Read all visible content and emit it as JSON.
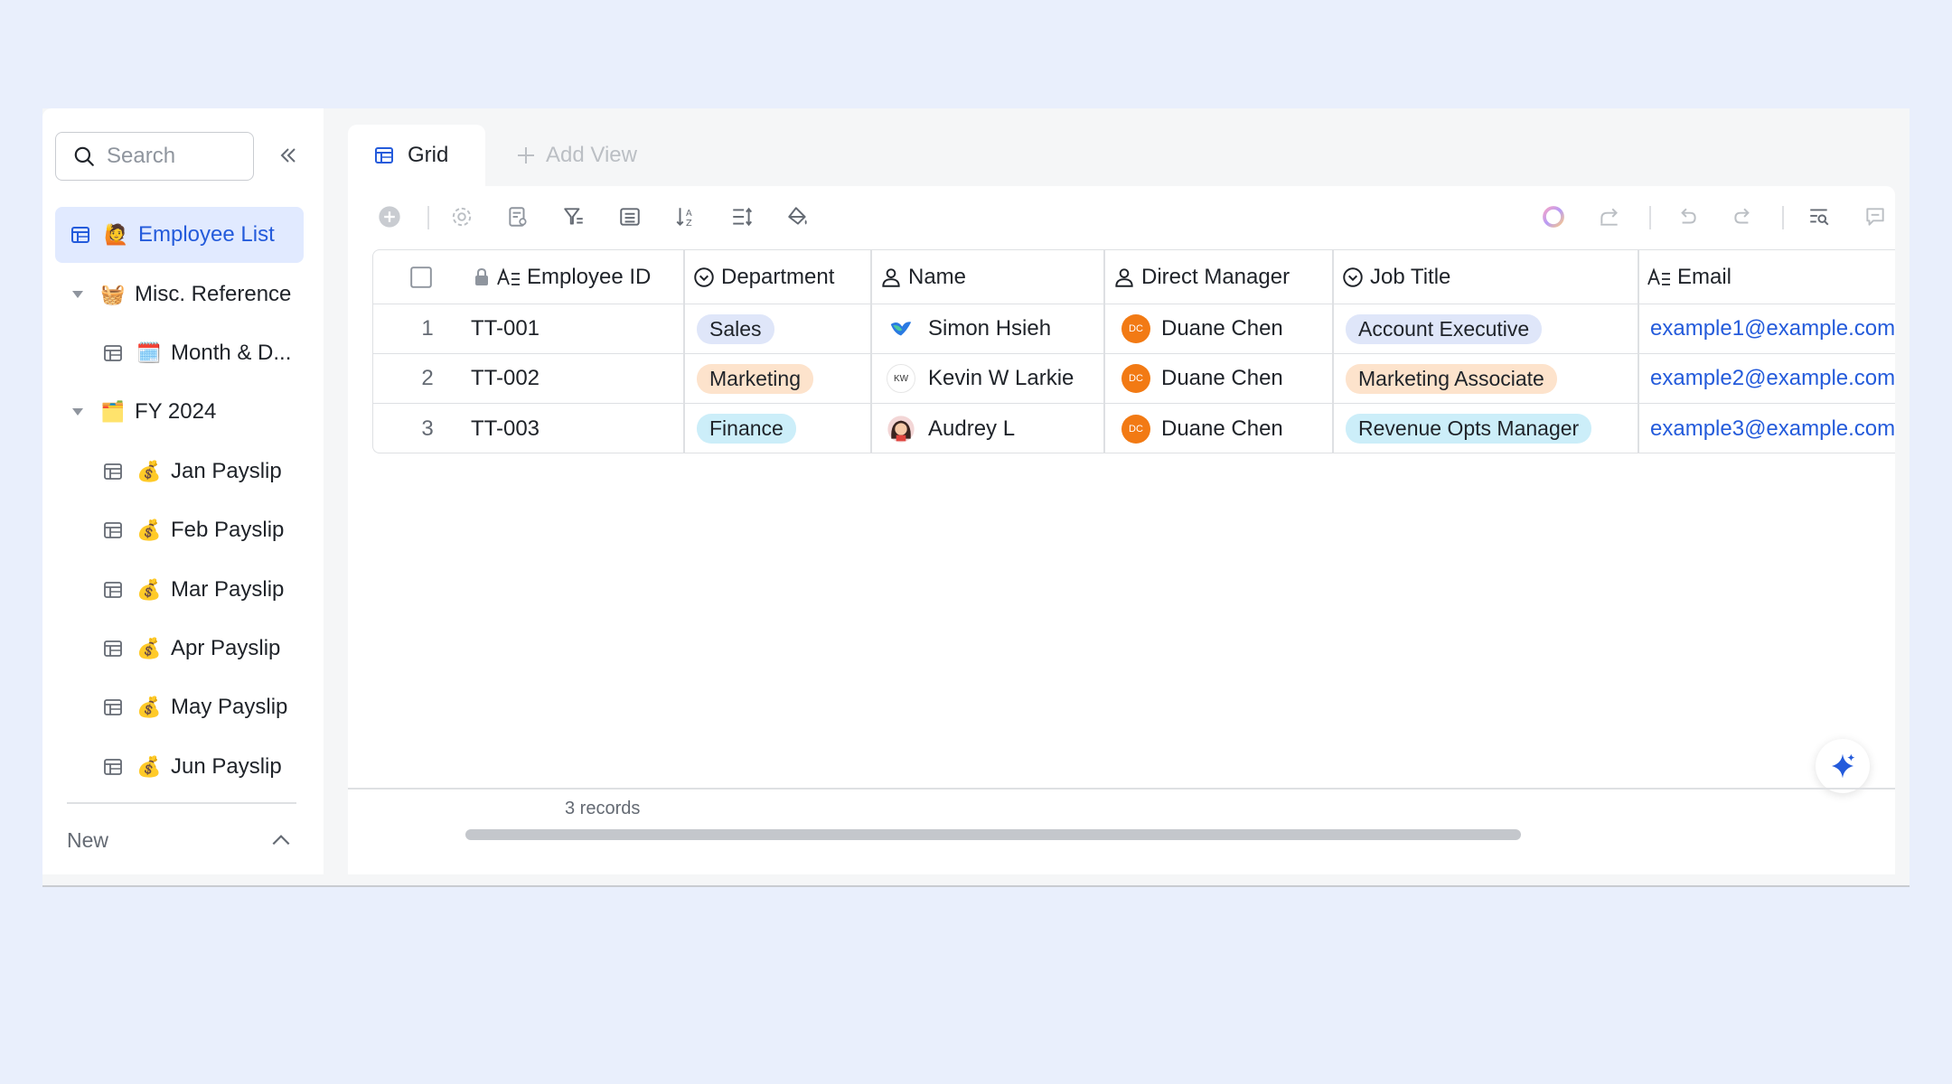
{
  "sidebar": {
    "search_placeholder": "Search",
    "items": [
      {
        "label": "Employee List",
        "emoji": "🙋",
        "active": true
      },
      {
        "label": "Misc. Reference",
        "emoji": "🧺",
        "folder": true
      },
      {
        "label": "Month & D...",
        "emoji": "🗓️"
      },
      {
        "label": "FY 2024",
        "emoji": "🗂️",
        "folder": true
      },
      {
        "label": "Jan Payslip",
        "emoji": "💰"
      },
      {
        "label": "Feb Payslip",
        "emoji": "💰"
      },
      {
        "label": "Mar Payslip",
        "emoji": "💰"
      },
      {
        "label": "Apr Payslip",
        "emoji": "💰"
      },
      {
        "label": "May Payslip",
        "emoji": "💰"
      },
      {
        "label": "Jun Payslip",
        "emoji": "💰"
      }
    ],
    "new_label": "New"
  },
  "tabs": {
    "grid_label": "Grid",
    "add_view_label": "Add View"
  },
  "table": {
    "columns": [
      "Employee ID",
      "Department",
      "Name",
      "Direct Manager",
      "Job Title",
      "Email"
    ],
    "rows": [
      {
        "num": "1",
        "id": "TT-001",
        "department": "Sales",
        "name": "Simon Hsieh",
        "manager": "Duane Chen",
        "manager_initials": "DC",
        "job": "Account Executive",
        "email": "example1@example.com"
      },
      {
        "num": "2",
        "id": "TT-002",
        "department": "Marketing",
        "name": "Kevin W Larkie",
        "name_initials": "KW",
        "manager": "Duane Chen",
        "manager_initials": "DC",
        "job": "Marketing Associate",
        "email": "example2@example.com"
      },
      {
        "num": "3",
        "id": "TT-003",
        "department": "Finance",
        "name": "Audrey L",
        "manager": "Duane Chen",
        "manager_initials": "DC",
        "job": "Revenue Opts Manager",
        "email": "example3@example.com"
      }
    ]
  },
  "footer": {
    "records": "3 records"
  },
  "colors": {
    "accent": "#245bdb",
    "background": "#e9effc",
    "sales_pill": "#dfe6f9",
    "marketing_pill": "#fde3cc",
    "finance_pill": "#cceef9",
    "manager_avatar": "#f27a14"
  }
}
